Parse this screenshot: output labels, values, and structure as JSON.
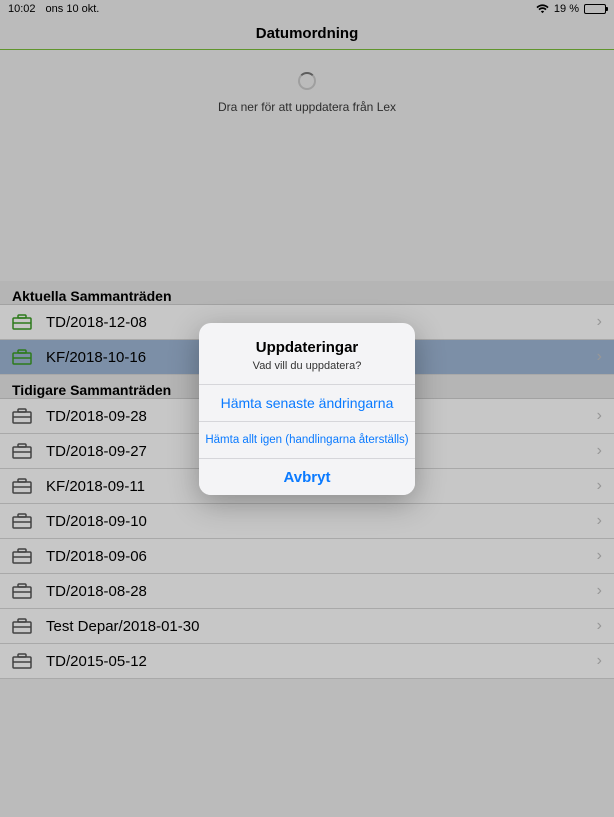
{
  "status": {
    "time": "10:02",
    "date": "ons 10 okt.",
    "battery_pct": "19 %"
  },
  "nav": {
    "title": "Datumordning"
  },
  "refresh": {
    "hint": "Dra ner för att uppdatera från Lex"
  },
  "sections": {
    "current_header": "Aktuella Sammanträden",
    "previous_header": "Tidigare Sammanträden"
  },
  "current": [
    {
      "label": "TD/2018-12-08"
    },
    {
      "label": "KF/2018-10-16"
    }
  ],
  "previous": [
    {
      "label": "TD/2018-09-28"
    },
    {
      "label": "TD/2018-09-27"
    },
    {
      "label": "KF/2018-09-11"
    },
    {
      "label": "TD/2018-09-10"
    },
    {
      "label": "TD/2018-09-06"
    },
    {
      "label": "TD/2018-08-28"
    },
    {
      "label": "Test Depar/2018-01-30"
    },
    {
      "label": "TD/2015-05-12"
    }
  ],
  "alert": {
    "title": "Uppdateringar",
    "message": "Vad vill du uppdatera?",
    "action1": "Hämta senaste ändringarna",
    "action2": "Hämta allt igen (handlingarna återställs)",
    "cancel": "Avbryt"
  }
}
